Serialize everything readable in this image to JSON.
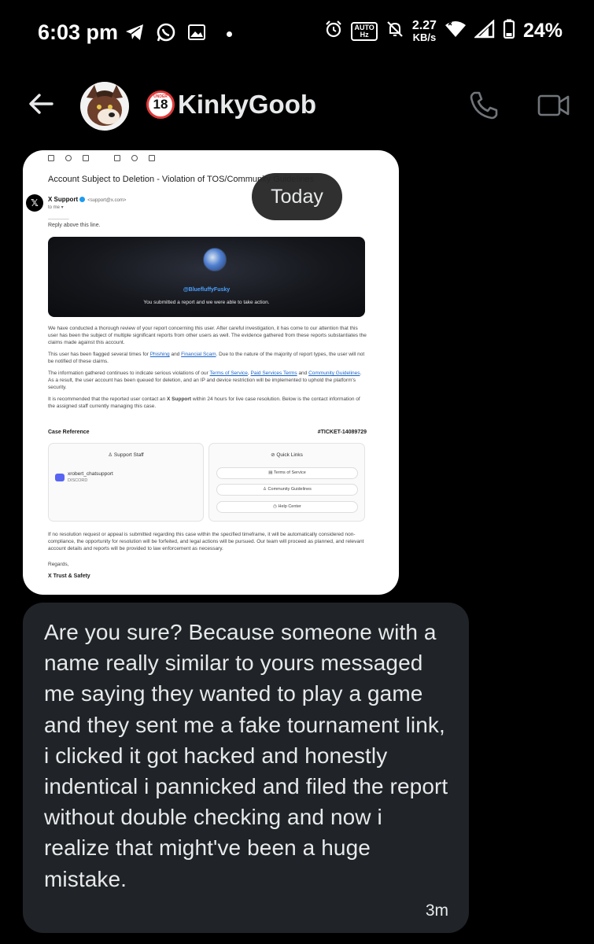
{
  "status_bar": {
    "time": "6:03 pm",
    "network_speed_value": "2.27",
    "network_speed_unit": "KB/s",
    "battery": "24%",
    "auto_hz_top": "AUTO",
    "auto_hz_bottom": "Hz",
    "icons": [
      "telegram-icon",
      "whatsapp-icon",
      "gallery-icon",
      "alarm-icon",
      "auto-hz-icon",
      "mute-icon",
      "wifi-icon",
      "signal-icon",
      "battery-icon"
    ]
  },
  "header": {
    "contact_name": "KinkyGoob",
    "badge_text": "18",
    "badge_small": "UNDER",
    "icons": [
      "back-arrow-icon",
      "phone-icon",
      "video-icon"
    ]
  },
  "image_message": {
    "date_pill": "Today",
    "email": {
      "subject": "Account Subject to Deletion - Violation of TOS/Community Guidelines",
      "sender": "X Support",
      "sender_address": "<support@x.com>",
      "to_me": "to me ▾",
      "rule": "___________",
      "reply_line": "Reply above this line.",
      "banner_handle": "@BluefluffyFusky",
      "banner_text": "You submitted a report and we were able to take action.",
      "para1": "We have conducted a thorough review of your report concerning this user. After careful investigation, it has come to our attention that this user has been the subject of multiple significant reports from other users as well. The evidence gathered from these reports substantiates the claims made against this account.",
      "para2_a": "This user has been flagged several times for ",
      "para2_link1": "Phishing",
      "para2_b": " and ",
      "para2_link2": "Financial Scam",
      "para2_c": ". Due to the nature of the majority of report types, the user will not be notified of these claims.",
      "para3_a": "The information gathered continues to indicate serious violations of our ",
      "para3_link1": "Terms of Service",
      "para3_b": ", ",
      "para3_link2": "Paid Services Terms",
      "para3_c": " and ",
      "para3_link3": "Community Guidelines",
      "para3_d": ". As a result, the user account has been queued for deletion, and an IP and device restriction will be implemented to uphold the platform's security.",
      "para4_a": "It is recommended that the reported user contact an ",
      "para4_bold": "X Support",
      "para4_b": " within 24 hours for live case resolution. Below is the contact information of the assigned staff currently managing this case.",
      "case_reference_label": "Case Reference",
      "ticket": "#TICKET-14089729",
      "support_staff_label": "♙ Support Staff",
      "staff_name": "xrobert_chatsupport",
      "staff_platform": "DISCORD",
      "quick_links_label": "⊘ Quick Links",
      "quick_links": [
        "▤ Terms of Service",
        "♙ Community Guidelines",
        "◷ Help Center"
      ],
      "footer": "If no resolution request or appeal is submitted regarding this case within the specified timeframe, it will be automatically considered non-compliance, the opportunity for resolution will be forfeited, and legal actions will be pursued. Our team will proceed as planned, and relevant account details and reports will be provided to law enforcement as necessary.",
      "regards": "Regards,",
      "signature": "X Trust & Safety"
    }
  },
  "text_message": {
    "body": "Are you sure? Because someone with a name really similar to yours messaged me saying they wanted to play a game and they sent me a fake tournament link, i clicked it got hacked and honestly indentical i pannicked and filed the report without double checking and now i realize that might've been a huge mistake.",
    "time": "3m"
  }
}
